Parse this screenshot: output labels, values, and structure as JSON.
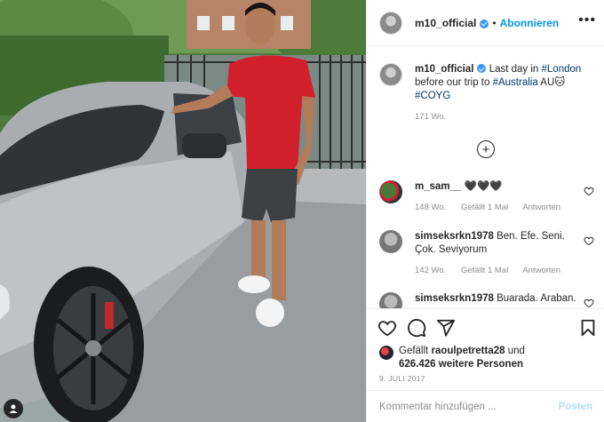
{
  "post": {
    "username": "m10_official",
    "verified": true,
    "follow_label": "Abonnieren",
    "more_icon": "more-horizontal-icon"
  },
  "caption": {
    "username": "m10_official",
    "text_before": "Last day in ",
    "tag_london": "#London",
    "text_middle": " before our trip to ",
    "tag_australia": "#Australia",
    "emoji_text": " AU🐱",
    "tag_coyg": "#COYG",
    "age": "171 Wo."
  },
  "load_more_label": "+",
  "comments": [
    {
      "username": "m_sam__",
      "text": "🖤🖤🖤",
      "age": "148 Wo.",
      "likes": "Gefällt 1 Mal",
      "reply": "Antworten"
    },
    {
      "username": "simseksrkn1978",
      "text": "Ben. Efe. Seni. Çok. Seviyorum",
      "age": "142 Wo.",
      "likes": "Gefällt 1 Mal",
      "reply": "Antworten"
    },
    {
      "username": "simseksrkn1978",
      "text": "Buarada. Araban."
    }
  ],
  "likes": {
    "prefix": "Gefällt ",
    "user": "raoulpetretta28",
    "middle": " und",
    "count": "626.426 weitere Personen"
  },
  "date": "9. JULI 2017",
  "add_comment": {
    "placeholder": "Kommentar hinzufügen ...",
    "post_label": "Posten"
  },
  "colors": {
    "accent": "#0095f6",
    "verified": "#3897f0",
    "muted": "#8e8e8e"
  }
}
